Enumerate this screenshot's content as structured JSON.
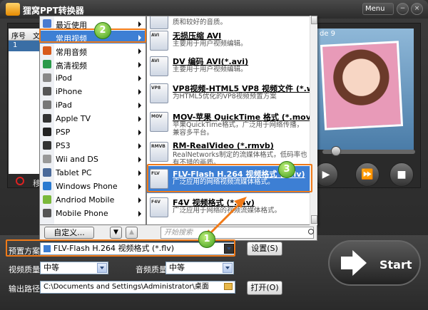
{
  "app": {
    "title": "狸窝PPT转换器",
    "menu_label": "Menu"
  },
  "table": {
    "headers": [
      "序号",
      "文"
    ],
    "rows": [
      [
        "1",
        ""
      ]
    ]
  },
  "preview": {
    "slide_label": "de 9"
  },
  "remove_label": "移",
  "menu": {
    "items": [
      {
        "label": "最近使用",
        "icon": "clock-icon",
        "color": "#4a7bd0"
      },
      {
        "label": "常用视频",
        "icon": "video-icon",
        "color": "#3d7fd4",
        "active": true
      },
      {
        "label": "常用音频",
        "icon": "audio-icon",
        "color": "#d85a1a"
      },
      {
        "label": "高清视频",
        "icon": "hd-video-icon",
        "color": "#2a9a4a"
      },
      {
        "label": "iPod",
        "icon": "ipod-icon",
        "color": "#888"
      },
      {
        "label": "iPhone",
        "icon": "iphone-icon",
        "color": "#555"
      },
      {
        "label": "iPad",
        "icon": "ipad-icon",
        "color": "#777"
      },
      {
        "label": "Apple TV",
        "icon": "appletv-icon",
        "color": "#333"
      },
      {
        "label": "PSP",
        "icon": "psp-icon",
        "color": "#222"
      },
      {
        "label": "PS3",
        "icon": "ps3-icon",
        "color": "#333"
      },
      {
        "label": "Wii and DS",
        "icon": "wii-icon",
        "color": "#999"
      },
      {
        "label": "Tablet PC",
        "icon": "tablet-icon",
        "color": "#4a6a9a"
      },
      {
        "label": "Windows Phone",
        "icon": "windows-phone-icon",
        "color": "#2a7ad0"
      },
      {
        "label": "Andriod Mobile",
        "icon": "android-icon",
        "color": "#7ab83a"
      },
      {
        "label": "Mobile Phone",
        "icon": "mobile-phone-icon",
        "color": "#555"
      }
    ],
    "customize_label": "自定义..."
  },
  "formats": [
    {
      "title": "",
      "desc": "质和较好的音质。",
      "tag": ""
    },
    {
      "title": "无损压缩 AVI",
      "desc": "主要用于用户视频编辑。",
      "tag": "AVI"
    },
    {
      "title": "DV 编码 AVI(*.avi)",
      "desc": "主要用于用户视频编辑。",
      "tag": "AVI"
    },
    {
      "title": "VP8视频-HTML5 VP8 视频文件 (*.webm)",
      "desc": "为HTML5优化的VP8视频预置方案",
      "tag": "VP8"
    },
    {
      "title": "MOV-苹果 QuickTime 格式 (*.mov)",
      "desc": "苹果QuickTime格式，广泛用于网络传播，兼容多平台。",
      "tag": "MOV"
    },
    {
      "title": "RM-RealVideo (*.rmvb)",
      "desc": "RealNetworks制定的流媒体格式，低码率也有不错的画质。",
      "tag": "RMVB"
    },
    {
      "title": "FLV-Flash H.264 视频格式 (*.flv)",
      "desc": "广泛应用的网络视频流媒体格式。",
      "tag": "FLV",
      "selected": true
    },
    {
      "title": "F4V 视频格式 (*.f4v)",
      "desc": "广泛应用于网络的视频流媒体格式。",
      "tag": "F4V"
    }
  ],
  "search": {
    "placeholder": "开始搜索"
  },
  "preset": {
    "label": "预置方案:",
    "value": "FLV-Flash H.264 视频格式 (*.flv)",
    "settings_label": "设置(S)"
  },
  "video_quality": {
    "label": "视频质量:",
    "value": "中等"
  },
  "audio_quality": {
    "label": "音频质量:",
    "value": "中等"
  },
  "output": {
    "label": "输出路径:",
    "value": "C:\\Documents and Settings\\Administrator\\桌面",
    "open_label": "打开(O)"
  },
  "start_label": "Start",
  "badges": [
    "1",
    "2",
    "3"
  ]
}
